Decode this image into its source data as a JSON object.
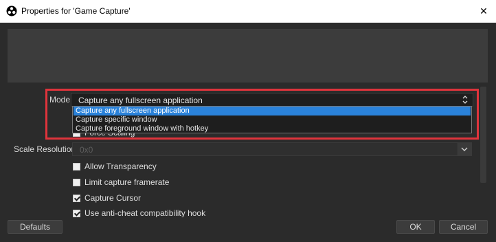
{
  "window": {
    "title": "Properties for 'Game Capture'",
    "close_glyph": "✕"
  },
  "mode": {
    "label": "Mode",
    "selected": "Capture any fullscreen application",
    "options": [
      "Capture any fullscreen application",
      "Capture specific window",
      "Capture foreground window with hotkey"
    ]
  },
  "hidden_row_label": "Force Scaling",
  "scale_resolution": {
    "label": "Scale Resolution",
    "value": "0x0"
  },
  "checkboxes": [
    {
      "label": "Allow Transparency",
      "checked": false
    },
    {
      "label": "Limit capture framerate",
      "checked": false
    },
    {
      "label": "Capture Cursor",
      "checked": true
    },
    {
      "label": "Use anti-cheat compatibility hook",
      "checked": true
    }
  ],
  "buttons": {
    "defaults": "Defaults",
    "ok": "OK",
    "cancel": "Cancel"
  },
  "colors": {
    "highlight": "#e0343c",
    "selected_option": "#2a82da",
    "background": "#2b2b2b"
  },
  "icons": {
    "app": "obs-logo-icon",
    "close": "close-icon",
    "combo_arrow": "updown-chevron-icon",
    "scale_arrow": "chevron-down-icon"
  }
}
